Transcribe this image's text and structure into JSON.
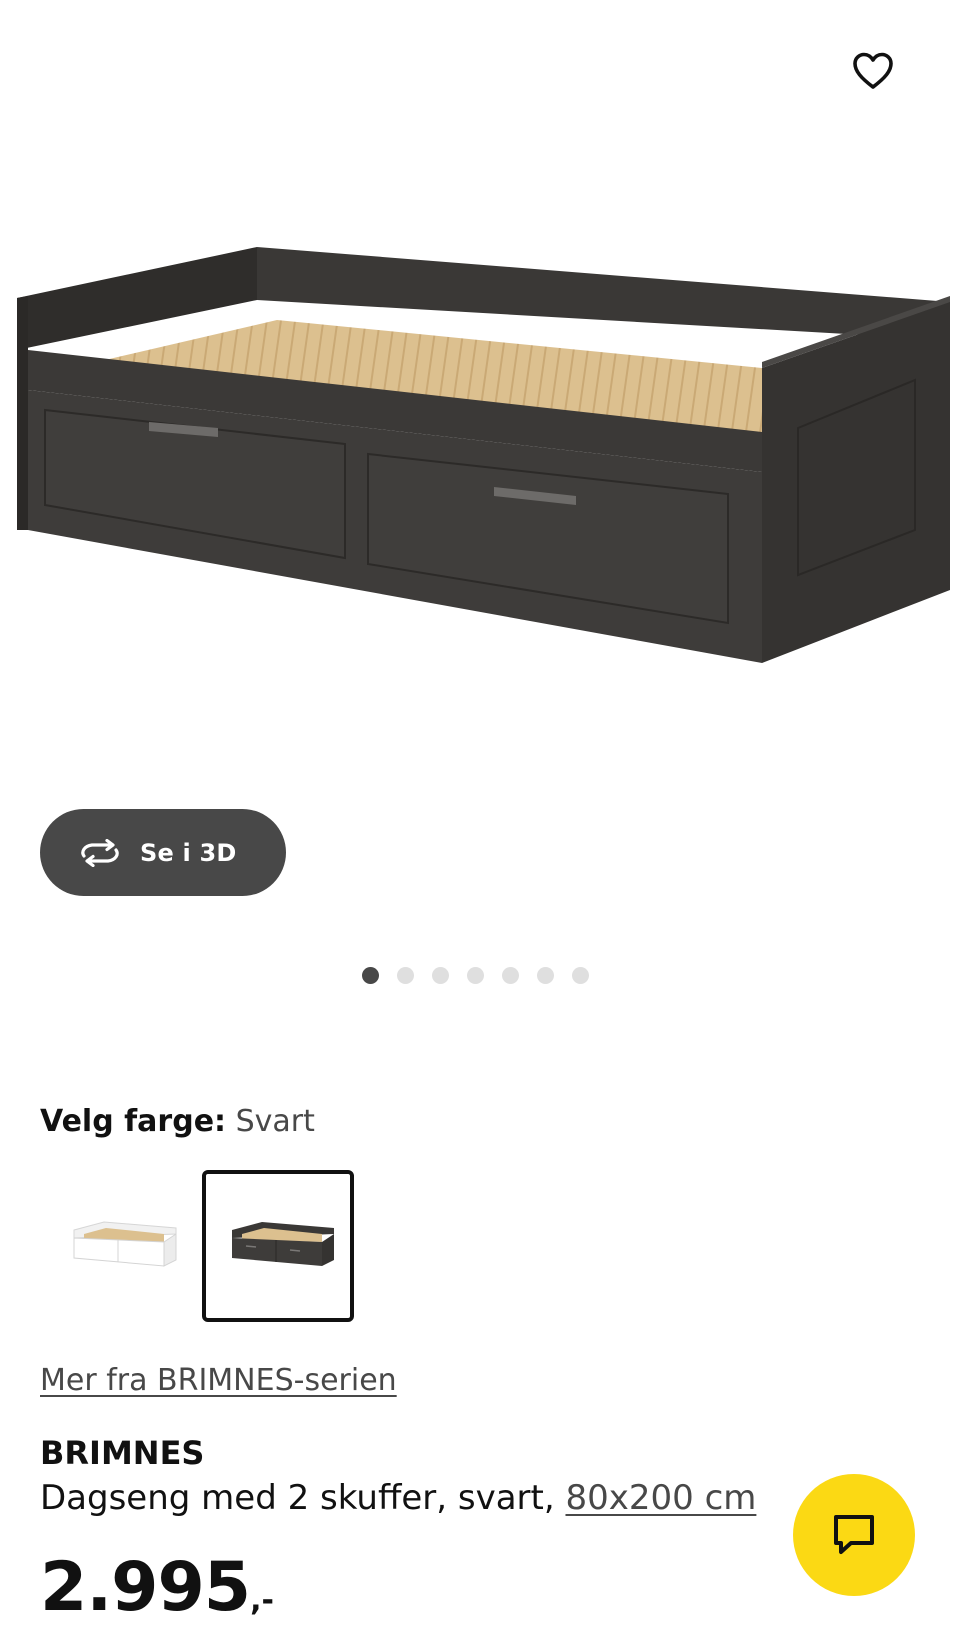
{
  "wishlist": {
    "icon": "heart-outline-icon"
  },
  "gallery": {
    "image_alt": "BRIMNES dagseng, svart",
    "view_3d_label": "Se i 3D",
    "view_3d_icon": "rotate-3d-icon",
    "slide_count": 7,
    "active_slide": 1
  },
  "color_picker": {
    "label": "Velg farge:",
    "selected_value": "Svart",
    "options": [
      {
        "name": "Hvit",
        "selected": false
      },
      {
        "name": "Svart",
        "selected": true
      }
    ]
  },
  "series_link": "Mer fra BRIMNES-serien",
  "product": {
    "name": "BRIMNES",
    "description": "Dagseng med 2 skuffer, svart,",
    "size": "80x200 cm",
    "price": "2.995",
    "price_suffix": ",-"
  },
  "chat": {
    "icon": "chat-bubble-icon"
  },
  "colors": {
    "accent_yellow": "#fbd914",
    "dark_gray": "#484848",
    "dot_inactive": "#dfdfdf",
    "text": "#111111"
  }
}
